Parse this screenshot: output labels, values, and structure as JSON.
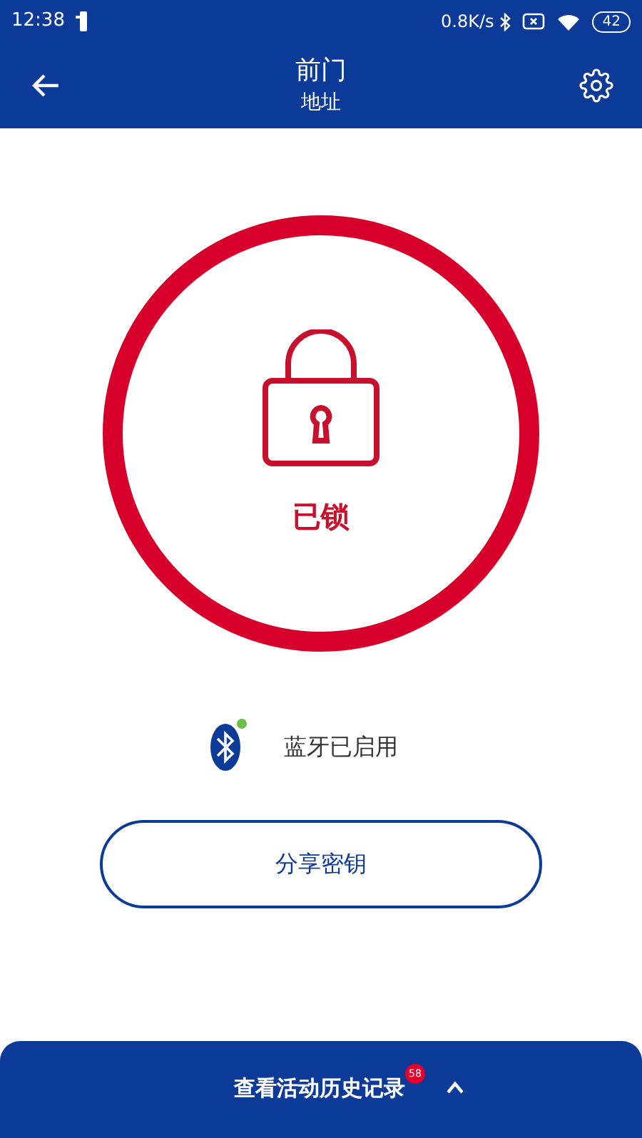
{
  "status_bar": {
    "time": "12:38",
    "speed": "0.8K/s",
    "battery": "42"
  },
  "header": {
    "title": "前门",
    "subtitle": "地址"
  },
  "lock": {
    "locked": true,
    "status": "已锁"
  },
  "bluetooth": {
    "enabled": true,
    "label": "蓝牙已启用"
  },
  "share_button": "分享密钥",
  "history_bar": {
    "label": "查看活动历史记录",
    "badge": "58",
    "expanded": false
  }
}
